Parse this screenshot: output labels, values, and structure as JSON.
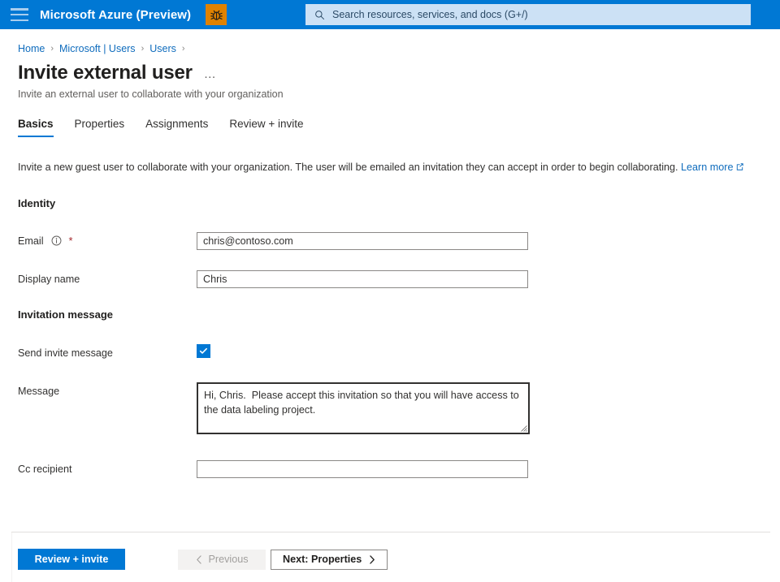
{
  "topbar": {
    "menu_icon": "hamburger-icon",
    "brand": "Microsoft Azure (Preview)",
    "bug_icon": "bug-icon",
    "search": {
      "icon": "search-icon",
      "placeholder": "Search resources, services, and docs (G+/)",
      "value": ""
    },
    "accent_color": "#0078d4",
    "bug_badge_color": "#e08200"
  },
  "breadcrumb": {
    "items": [
      "Home",
      "Microsoft | Users",
      "Users"
    ],
    "separator": "›",
    "trailing_separator": "›"
  },
  "header": {
    "title": "Invite external user",
    "more_menu": "…",
    "subtitle": "Invite an external user to collaborate with your organization"
  },
  "tabs": [
    {
      "label": "Basics",
      "active": true
    },
    {
      "label": "Properties",
      "active": false
    },
    {
      "label": "Assignments",
      "active": false
    },
    {
      "label": "Review + invite",
      "active": false
    }
  ],
  "intro": {
    "text": "Invite a new guest user to collaborate with your organization. The user will be emailed an invitation they can accept in order to begin collaborating.",
    "link_label": "Learn more",
    "link_icon": "external-link-icon",
    "link_color": "#0f6cbd"
  },
  "sections": {
    "identity": {
      "heading": "Identity",
      "email": {
        "label": "Email",
        "info_icon": "info-icon",
        "required_marker": "*",
        "value": "chris@contoso.com",
        "placeholder": ""
      },
      "display_name": {
        "label": "Display name",
        "value": "Chris",
        "placeholder": ""
      }
    },
    "invitation_message": {
      "heading": "Invitation message",
      "send_invite": {
        "label": "Send invite message",
        "checked": true,
        "check_icon": "checkmark-icon"
      },
      "message": {
        "label": "Message",
        "value": "Hi, Chris.  Please accept this invitation so that you will have access to the data labeling project.",
        "placeholder": ""
      },
      "cc_recipient": {
        "label": "Cc recipient",
        "value": "",
        "placeholder": ""
      }
    }
  },
  "footer": {
    "review_invite": "Review + invite",
    "previous": "Previous",
    "previous_icon": "chevron-left-icon",
    "previous_disabled": true,
    "next": "Next: Properties",
    "next_icon": "chevron-right-icon"
  }
}
